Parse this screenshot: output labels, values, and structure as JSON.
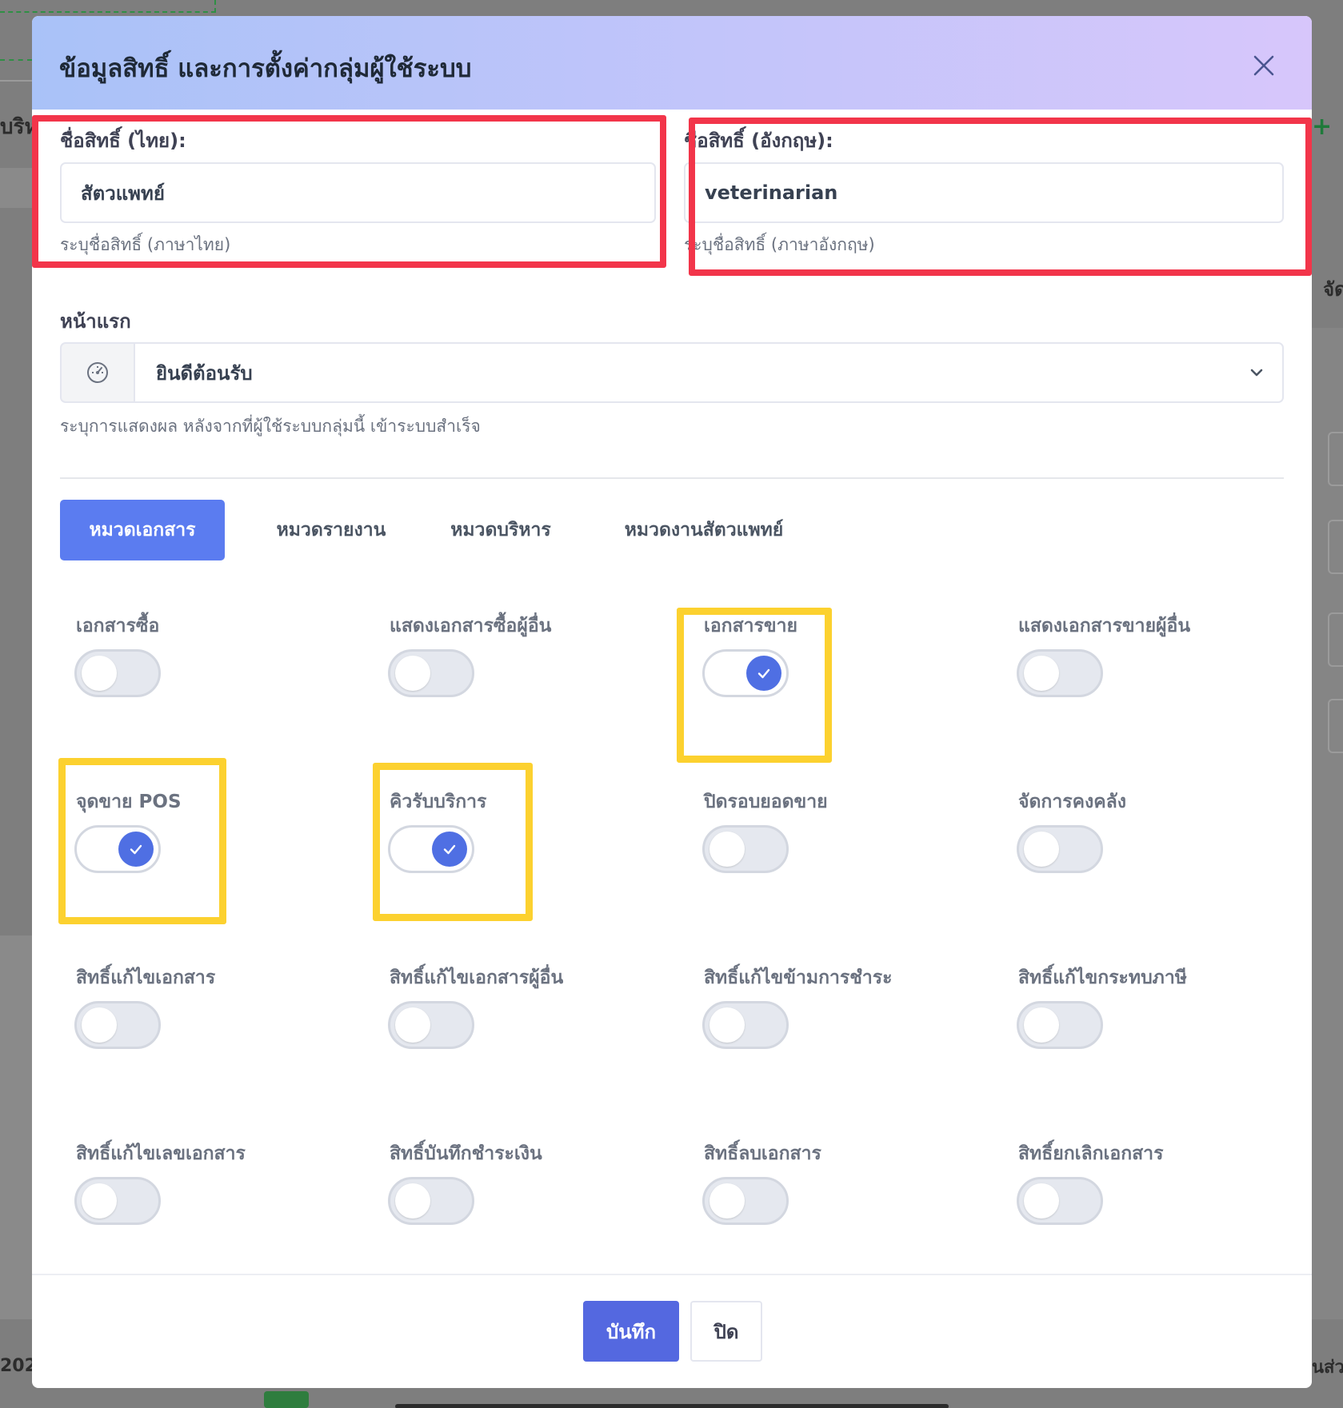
{
  "backdrop": {
    "left_fragment_1": "บริห",
    "left_fragment_2": "202",
    "right_fragment_1": "จัด",
    "right_fragment_2": "นส่ว",
    "plus_symbol": "+"
  },
  "modal": {
    "title": "ข้อมูลสิทธิ์ และการตั้งค่ากลุ่มผู้ใช้ระบบ",
    "close_icon": "close-icon"
  },
  "form": {
    "name_th": {
      "label": "ชื่อสิทธิ์ (ไทย):",
      "value": "สัตวแพทย์",
      "hint": "ระบุชื่อสิทธิ์ (ภาษาไทย)"
    },
    "name_en": {
      "label": "ชื่อสิทธิ์ (อังกฤษ):",
      "value": "veterinarian",
      "hint": "ระบุชื่อสิทธิ์ (ภาษาอังกฤษ)"
    },
    "homepage": {
      "label": "หน้าแรก",
      "icon": "dashboard-gauge-icon",
      "selected": "ยินดีต้อนรับ",
      "hint": "ระบุการแสดงผล หลังจากที่ผู้ใช้ระบบกลุ่มนี้ เข้าระบบสำเร็จ"
    }
  },
  "tabs": [
    {
      "label": "หมวดเอกสาร",
      "active": true
    },
    {
      "label": "หมวดรายงาน",
      "active": false
    },
    {
      "label": "หมวดบริหาร",
      "active": false
    },
    {
      "label": "หมวดงานสัตวแพทย์",
      "active": false
    }
  ],
  "permissions": [
    {
      "label": "เอกสารซื้อ",
      "enabled": false
    },
    {
      "label": "แสดงเอกสารซื้อผู้อื่น",
      "enabled": false
    },
    {
      "label": "เอกสารขาย",
      "enabled": true
    },
    {
      "label": "แสดงเอกสารขายผู้อื่น",
      "enabled": false
    },
    {
      "label": "จุดขาย POS",
      "enabled": true
    },
    {
      "label": "คิวรับบริการ",
      "enabled": true
    },
    {
      "label": "ปิดรอบยอดขาย",
      "enabled": false
    },
    {
      "label": "จัดการคงคลัง",
      "enabled": false
    },
    {
      "label": "สิทธิ์แก้ไขเอกสาร",
      "enabled": false
    },
    {
      "label": "สิทธิ์แก้ไขเอกสารผู้อื่น",
      "enabled": false
    },
    {
      "label": "สิทธิ์แก้ไขข้ามการชำระ",
      "enabled": false
    },
    {
      "label": "สิทธิ์แก้ไขกระทบภาษี",
      "enabled": false
    },
    {
      "label": "สิทธิ์แก้ไขเลขเอกสาร",
      "enabled": false
    },
    {
      "label": "สิทธิ์บันทึกชำระเงิน",
      "enabled": false
    },
    {
      "label": "สิทธิ์ลบเอกสาร",
      "enabled": false
    },
    {
      "label": "สิทธิ์ยกเลิกเอกสาร",
      "enabled": false
    }
  ],
  "footer": {
    "save_label": "บันทึก",
    "close_label": "ปิด"
  },
  "colors": {
    "accent": "#5468e0",
    "tab_active": "#5b7cf0",
    "toggle_on": "#4f6fe3",
    "highlight_red": "#f2354a",
    "highlight_yellow": "#fcd12f"
  }
}
